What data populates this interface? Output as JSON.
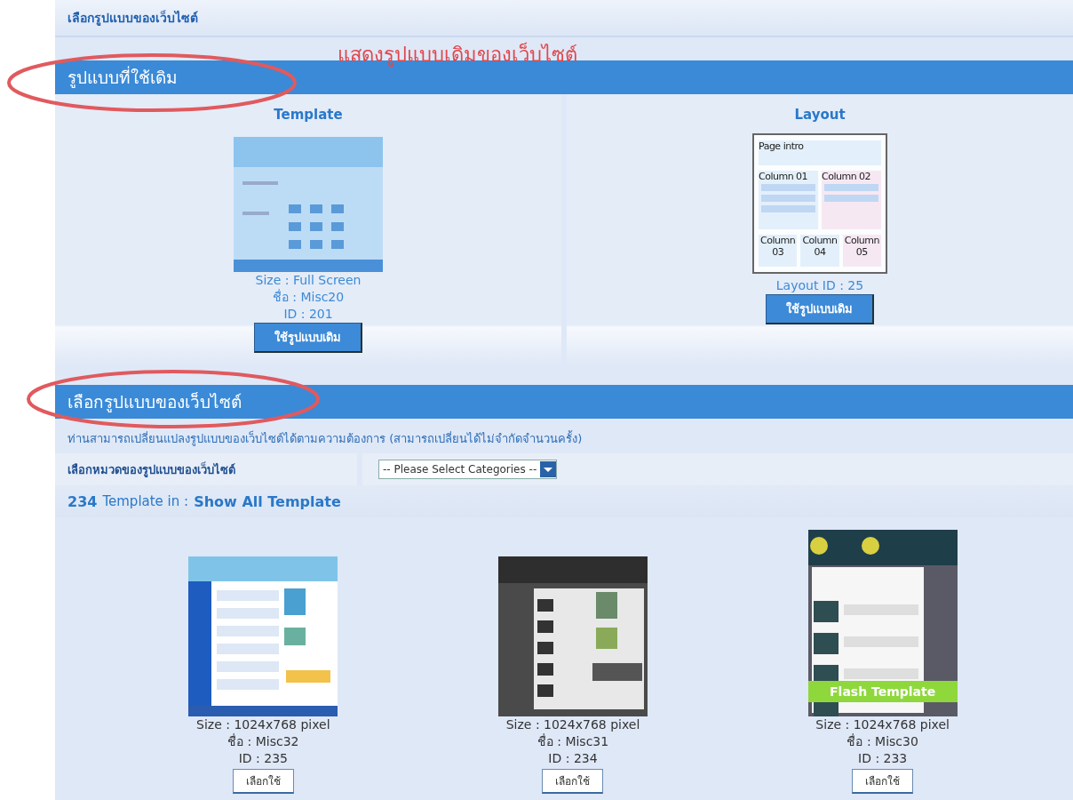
{
  "top_bar": {
    "title": "เลือกรูปแบบของเว็บไซต์"
  },
  "annotation": {
    "text": "แสดงรูปแบบเดิมของเว็บไซต์"
  },
  "current_section": {
    "title": "รูปแบบที่ใช้เดิม",
    "circled": true,
    "template": {
      "heading": "Template",
      "size": "Size : Full Screen",
      "name": "ชื่อ : Misc20",
      "id": "ID : 201",
      "button": "ใช้รูปแบบเดิม"
    },
    "layout": {
      "heading": "Layout",
      "page_intro": "Page intro",
      "columns": [
        "Column 01",
        "Column 02",
        "Column 03",
        "Column 04",
        "Column 05"
      ],
      "id": "Layout ID : 25",
      "button": "ใช้รูปแบบเดิม"
    }
  },
  "choose_section": {
    "title": "เลือกรูปแบบของเว็บไซต์",
    "circled": true,
    "description": "ท่านสามารถเปลี่ยนแปลงรูปแบบของเว็บไซต์ได้ตามความต้องการ (สามารถเปลี่ยนได้ไม่จำกัดจำนวนครั้ง)",
    "category_label": "เลือกหมวดของรูปแบบของเว็บไซต์",
    "category_select": {
      "value": "-- Please Select Categories --"
    },
    "count": "234",
    "count_text": "Template in :",
    "show_all_link": "Show All Template",
    "templates": [
      {
        "kind": "light",
        "size": "Size : 1024x768 pixel",
        "name": "ชื่อ : Misc32",
        "id": "ID : 235",
        "button": "เลือกใช้"
      },
      {
        "kind": "dark",
        "size": "Size : 1024x768 pixel",
        "name": "ชื่อ : Misc31",
        "id": "ID : 234",
        "button": "เลือกใช้"
      },
      {
        "kind": "flash",
        "badge": "Flash Template",
        "size": "Size : 1024x768 pixel",
        "name": "ชื่อ : Misc30",
        "id": "ID : 233",
        "button": "เลือกใช้"
      }
    ]
  }
}
